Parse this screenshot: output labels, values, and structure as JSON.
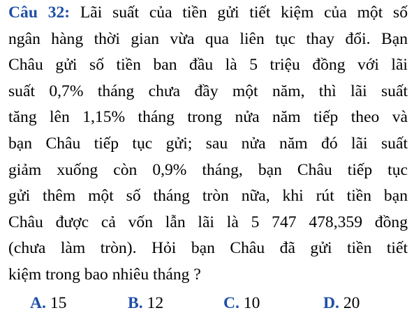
{
  "question": {
    "label": "Câu 32:",
    "lines": [
      " Lãi suất của tiền gửi tiết kiệm của một số",
      "ngân hàng thời gian vừa qua liên tục thay đổi. Bạn",
      "Châu gửi số tiền ban đầu là 5 triệu đồng với lãi",
      "suất 0,7% tháng chưa đầy một năm, thì lãi suất",
      "tăng lên 1,15% tháng trong nửa năm tiếp theo và",
      "bạn Châu tiếp tục gửi; sau nửa năm đó lãi suất",
      "giảm xuống còn 0,9% tháng, bạn Châu tiếp tục",
      "gửi thêm một số tháng tròn nữa, khi rút tiền bạn",
      "Châu được cả vốn lẫn lãi là 5 747 478,359 đồng",
      "(chưa làm tròn). Hỏi bạn Châu đã gửi tiền tiết",
      "kiệm trong bao nhiêu tháng ?"
    ]
  },
  "options": [
    {
      "letter": "A.",
      "value": " 15"
    },
    {
      "letter": "B.",
      "value": " 12"
    },
    {
      "letter": "C.",
      "value": " 10"
    },
    {
      "letter": "D.",
      "value": " 20"
    }
  ],
  "colors": {
    "label": "#1f4fa8",
    "text": "#000000",
    "background": "#ffffff"
  }
}
